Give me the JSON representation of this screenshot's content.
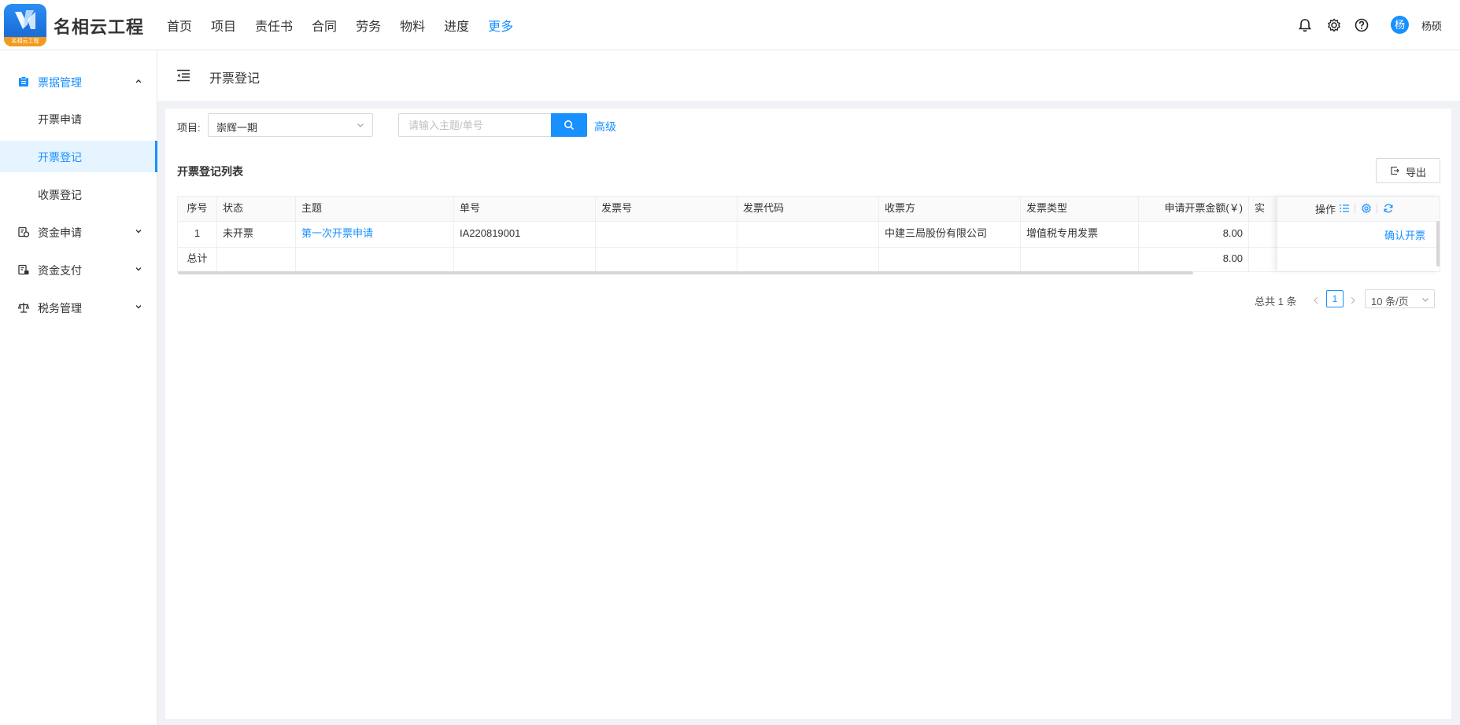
{
  "app": {
    "name": "名相云工程",
    "logo_caption": "名相云工程"
  },
  "nav": [
    "首页",
    "项目",
    "责任书",
    "合同",
    "劳务",
    "物料",
    "进度",
    "更多"
  ],
  "nav_active": "更多",
  "user": {
    "avatar_initial": "杨",
    "name": "杨硕"
  },
  "sidebar": {
    "groups": [
      {
        "label": "票据管理",
        "open": true,
        "icon": "invoice-folder-icon",
        "children": [
          "开票申请",
          "开票登记",
          "收票登记"
        ],
        "active_child": "开票登记"
      },
      {
        "label": "资金申请",
        "icon": "fund-apply-icon"
      },
      {
        "label": "资金支付",
        "icon": "fund-pay-icon"
      },
      {
        "label": "税务管理",
        "icon": "tax-scale-icon"
      }
    ]
  },
  "breadcrumb": "开票登记",
  "filter": {
    "project_label": "项目:",
    "project_value": "崇辉一期",
    "search_placeholder": "请输入主题/单号",
    "advanced": "高级"
  },
  "list": {
    "title": "开票登记列表",
    "export": "导出"
  },
  "table": {
    "columns": [
      "序号",
      "状态",
      "主题",
      "单号",
      "发票号",
      "发票代码",
      "收票方",
      "发票类型",
      "申请开票金额(￥)",
      "实"
    ],
    "ops_header": "操作",
    "rows": [
      {
        "index": "1",
        "status": "未开票",
        "subject": "第一次开票申请",
        "number": "IA220819001",
        "invoice_no": "",
        "invoice_code": "",
        "receiver": "中建三局股份有限公司",
        "invoice_type": "增值税专用发票",
        "amount": "8.00",
        "action": "确认开票"
      }
    ],
    "total": {
      "label": "总计",
      "amount": "8.00"
    }
  },
  "pagination": {
    "total_text": "总共 1 条",
    "current": "1",
    "page_size": "10 条/页"
  },
  "colors": {
    "primary": "#1890ff",
    "logo_orange": "#f39a1d"
  }
}
